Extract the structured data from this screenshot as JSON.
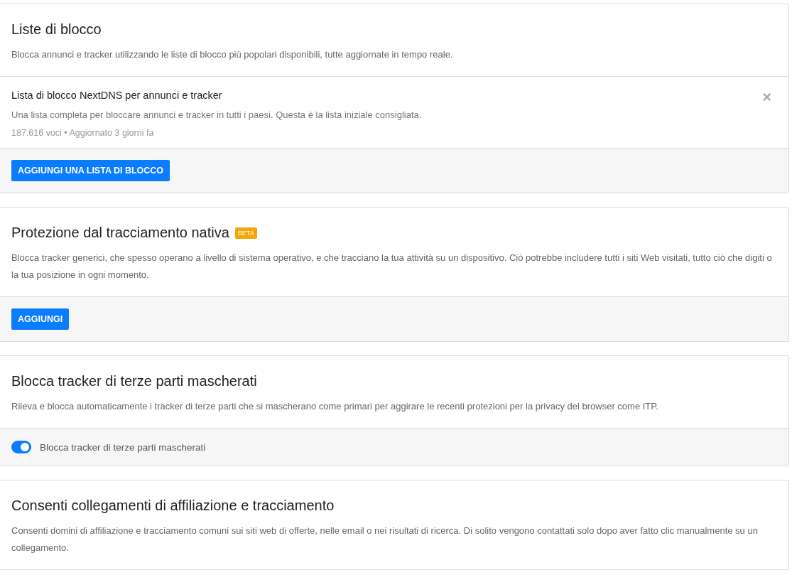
{
  "cards": [
    {
      "title": "Liste di blocco",
      "description": "Blocca annunci e tracker utilizzando le liste di blocco più popolari disponibili, tutte aggiornate in tempo reale.",
      "entries": [
        {
          "name": "Lista di blocco NextDNS per annunci e tracker",
          "description": "Una lista completa per bloccare annunci e tracker in tutti i paesi. Questa è la lista iniziale consigliata.",
          "meta": "187.616 voci • Aggiornato 3 giorni fa",
          "remove": "×"
        }
      ],
      "footer": {
        "kind": "button",
        "label": "AGGIUNGI UNA LISTA DI BLOCCO"
      }
    },
    {
      "title": "Protezione dal tracciamento nativa",
      "badge": "BETA",
      "description": "Blocca tracker generici, che spesso operano a livello di sistema operativo, e che tracciano la tua attività su un dispositivo. Ciò potrebbe includere tutti i siti Web visitati, tutto ciò che digiti o la tua posizione in ogni momento.",
      "footer": {
        "kind": "button",
        "label": "AGGIUNGI"
      }
    },
    {
      "title": "Blocca tracker di terze parti mascherati",
      "description": "Rileva e blocca automaticamente i tracker di terze parti che si mascherano come primari per aggirare le recenti protezioni per la privacy del browser come ITP.",
      "footer": {
        "kind": "toggle",
        "label": "Blocca tracker di terze parti mascherati",
        "on": true
      }
    },
    {
      "title": "Consenti collegamenti di affiliazione e tracciamento",
      "description": "Consenti domini di affiliazione e tracciamento comuni sui siti web di offerte, nelle email o nei risultati di ricerca. Di solito vengono contattati solo dopo aver fatto clic manualmente su un collegamento."
    }
  ]
}
